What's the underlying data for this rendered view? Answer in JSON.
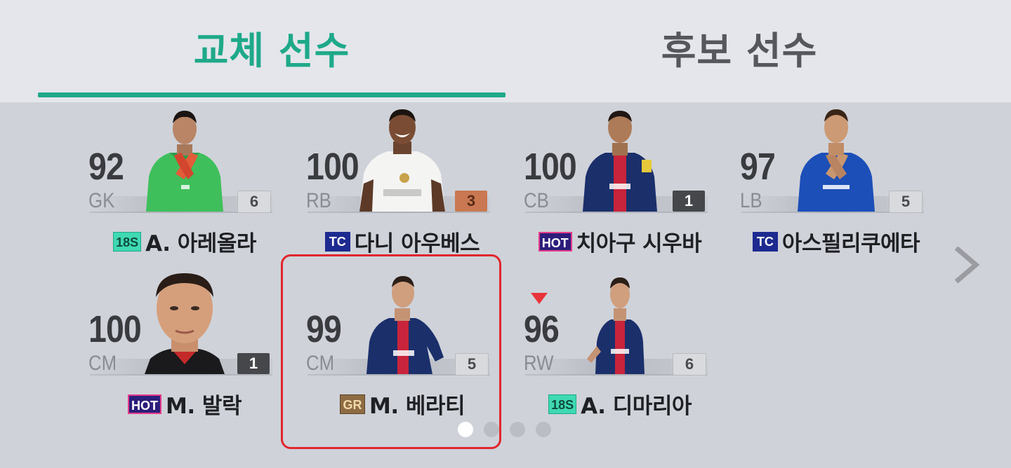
{
  "tabs": {
    "substitutes": "교체 선수",
    "candidates": "후보 선수"
  },
  "players": [
    {
      "ovr": "92",
      "pos": "GK",
      "level": "6",
      "badge": "18S",
      "name": "A. 아레올라"
    },
    {
      "ovr": "100",
      "pos": "RB",
      "level": "3",
      "badge": "TC",
      "name": "다니 아우베스"
    },
    {
      "ovr": "100",
      "pos": "CB",
      "level": "1",
      "badge": "HOT",
      "name": "치아구 시우바"
    },
    {
      "ovr": "97",
      "pos": "LB",
      "level": "5",
      "badge": "TC",
      "name": "아스필리쿠에타"
    },
    {
      "ovr": "100",
      "pos": "CM",
      "level": "1",
      "badge": "HOT",
      "name": "M. 발락"
    },
    {
      "ovr": "99",
      "pos": "CM",
      "level": "5",
      "badge": "GR",
      "name": "M. 베라티"
    },
    {
      "ovr": "96",
      "pos": "RW",
      "level": "6",
      "badge": "18S",
      "name": "A. 디마리아"
    }
  ],
  "pagination": {
    "total": 4,
    "active": 1
  },
  "colors": {
    "accent": "#1ea989",
    "selection": "#e1262d",
    "down_marker": "#e8343a"
  },
  "icons": {
    "next": "chevron-right-icon",
    "form_down": "triangle-down-icon"
  }
}
